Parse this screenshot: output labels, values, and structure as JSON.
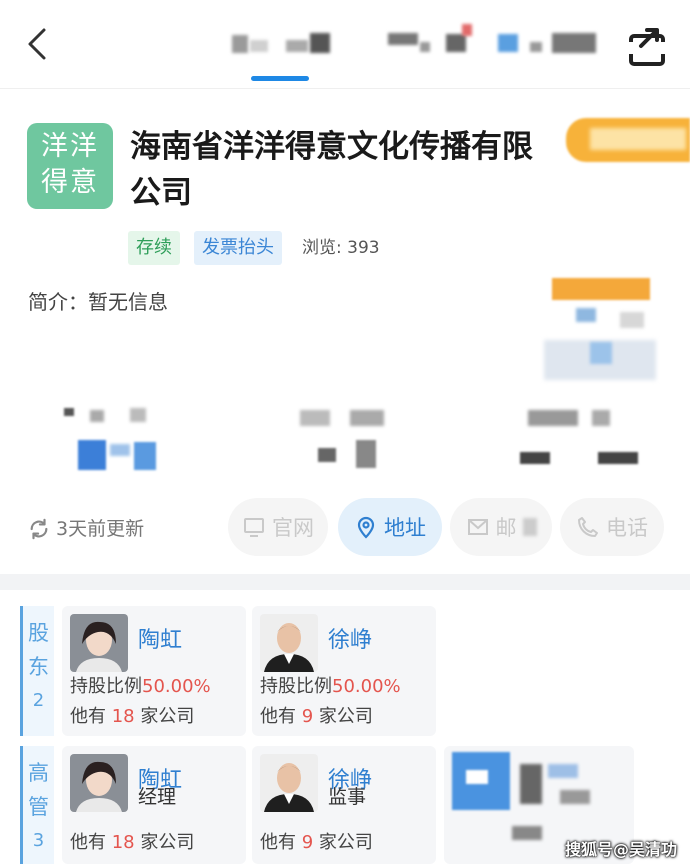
{
  "company": {
    "logo_text": "洋洋得意",
    "logo_line1": "洋洋",
    "logo_line2": "得意",
    "name": "海南省洋洋得意文化传播有限公司",
    "tags": [
      "存续",
      "发票抬头"
    ],
    "views_label": "浏览: 393",
    "intro_label": "简介：暂无信息"
  },
  "actions": {
    "updated": "3天前更新",
    "website": "官网",
    "address": "地址",
    "email": "邮",
    "phone": "电话"
  },
  "shareholders": {
    "label_chars": [
      "股",
      "东"
    ],
    "count": "2",
    "items": [
      {
        "name": "陶虹",
        "share_prefix": "持股比例",
        "share": "50.00%",
        "co_prefix": "他有",
        "co_count": "18",
        "co_suffix": "家公司"
      },
      {
        "name": "徐峥",
        "share_prefix": "持股比例",
        "share": "50.00%",
        "co_prefix": "他有",
        "co_count": "9",
        "co_suffix": "家公司"
      }
    ]
  },
  "executives": {
    "label_chars": [
      "高",
      "管"
    ],
    "count": "3",
    "items": [
      {
        "name": "陶虹",
        "role": "经理",
        "co_prefix": "他有",
        "co_count": "18",
        "co_suffix": "家公司"
      },
      {
        "name": "徐峥",
        "role": "监事",
        "co_prefix": "他有",
        "co_count": "9",
        "co_suffix": "家公司"
      }
    ]
  },
  "watermark": "搜狐号@吴清功",
  "colors": {
    "accent_blue": "#2f7fd0",
    "logo_green": "#6fc79f",
    "status_green": "#2e9e59",
    "highlight_red": "#e4554e"
  }
}
